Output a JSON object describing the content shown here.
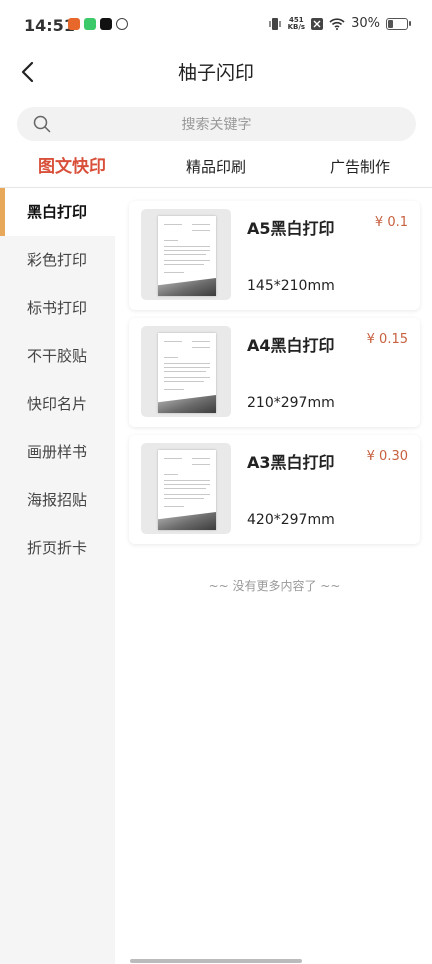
{
  "status_bar": {
    "time": "14:51",
    "netspeed_value": "451",
    "netspeed_unit": "KB/s",
    "battery": "30%",
    "battery_level": 0.3
  },
  "header": {
    "title": "柚子闪印"
  },
  "search": {
    "placeholder": "搜索关键字"
  },
  "tabs": [
    {
      "label": "图文快印",
      "active": true
    },
    {
      "label": "精品印刷",
      "active": false
    },
    {
      "label": "广告制作",
      "active": false
    }
  ],
  "categories": [
    {
      "label": "黑白打印",
      "active": true
    },
    {
      "label": "彩色打印"
    },
    {
      "label": "标书打印"
    },
    {
      "label": "不干胶贴"
    },
    {
      "label": "快印名片"
    },
    {
      "label": "画册样书"
    },
    {
      "label": "海报招贴"
    },
    {
      "label": "折页折卡"
    }
  ],
  "products": [
    {
      "name": "A5黑白打印",
      "price": "¥ 0.1",
      "size": "145*210mm"
    },
    {
      "name": "A4黑白打印",
      "price": "¥ 0.15",
      "size": "210*297mm"
    },
    {
      "name": "A3黑白打印",
      "price": "¥ 0.30",
      "size": "420*297mm"
    }
  ],
  "end_note": "~~ 没有更多内容了 ~~",
  "colors": {
    "accent": "#d9503a",
    "price": "#c7603f",
    "sidebar_marker": "#e7a85a"
  },
  "icons": [
    "back-arrow-icon",
    "search-icon",
    "wifi-icon",
    "signal-icon",
    "battery-icon"
  ]
}
